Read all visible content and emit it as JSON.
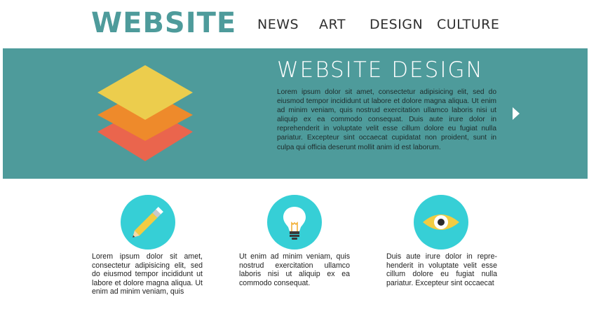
{
  "header": {
    "logo": "WEBSITE",
    "nav": [
      "NEWS",
      "ART",
      "DESIGN",
      "CULTURE"
    ]
  },
  "hero": {
    "title": "WEBSITE DESIGN",
    "body": "Lorem ipsum dolor sit amet, consectetur adipisicing elit, sed do eiusmod tempor incididunt ut labore et dolore magna aliqua. Ut enim ad minim veniam, quis nostrud exercitation ullamco laboris nisi ut aliquip ex ea commodo consequat. Duis aute irure dolor in reprehenderit in voluptate velit esse cillum dolore eu fugiat nulla pariatur. Excepteur sint occaecat cupidatat non proident, sunt in culpa qui officia deserunt mollit anim id est laborum.",
    "layer_colors": [
      "#eccd4d",
      "#ee8a2b",
      "#ea654d"
    ]
  },
  "features": [
    {
      "icon": "pencil-icon",
      "text": "Lorem ipsum dolor sit amet, consectetur adipisicing elit, sed do eiusmod tempor incidi­dunt ut labore et dolore magna aliqua. Ut enim ad minim veniam, quis"
    },
    {
      "icon": "lightbulb-icon",
      "text": "Ut enim ad minim veniam, quis nostrud exercitation ullamco laboris nisi ut aliquip ex ea commodo consequat."
    },
    {
      "icon": "eye-icon",
      "text": "Duis aute irure dolor in repre­henderit in voluptate velit esse cillum dolore eu fugiat nulla pariatur. Excepteur sint occae­cat"
    }
  ],
  "colors": {
    "brand": "#4e9b9b",
    "icon_circle": "#36cfd6",
    "accent_yellow": "#f2cc42"
  }
}
